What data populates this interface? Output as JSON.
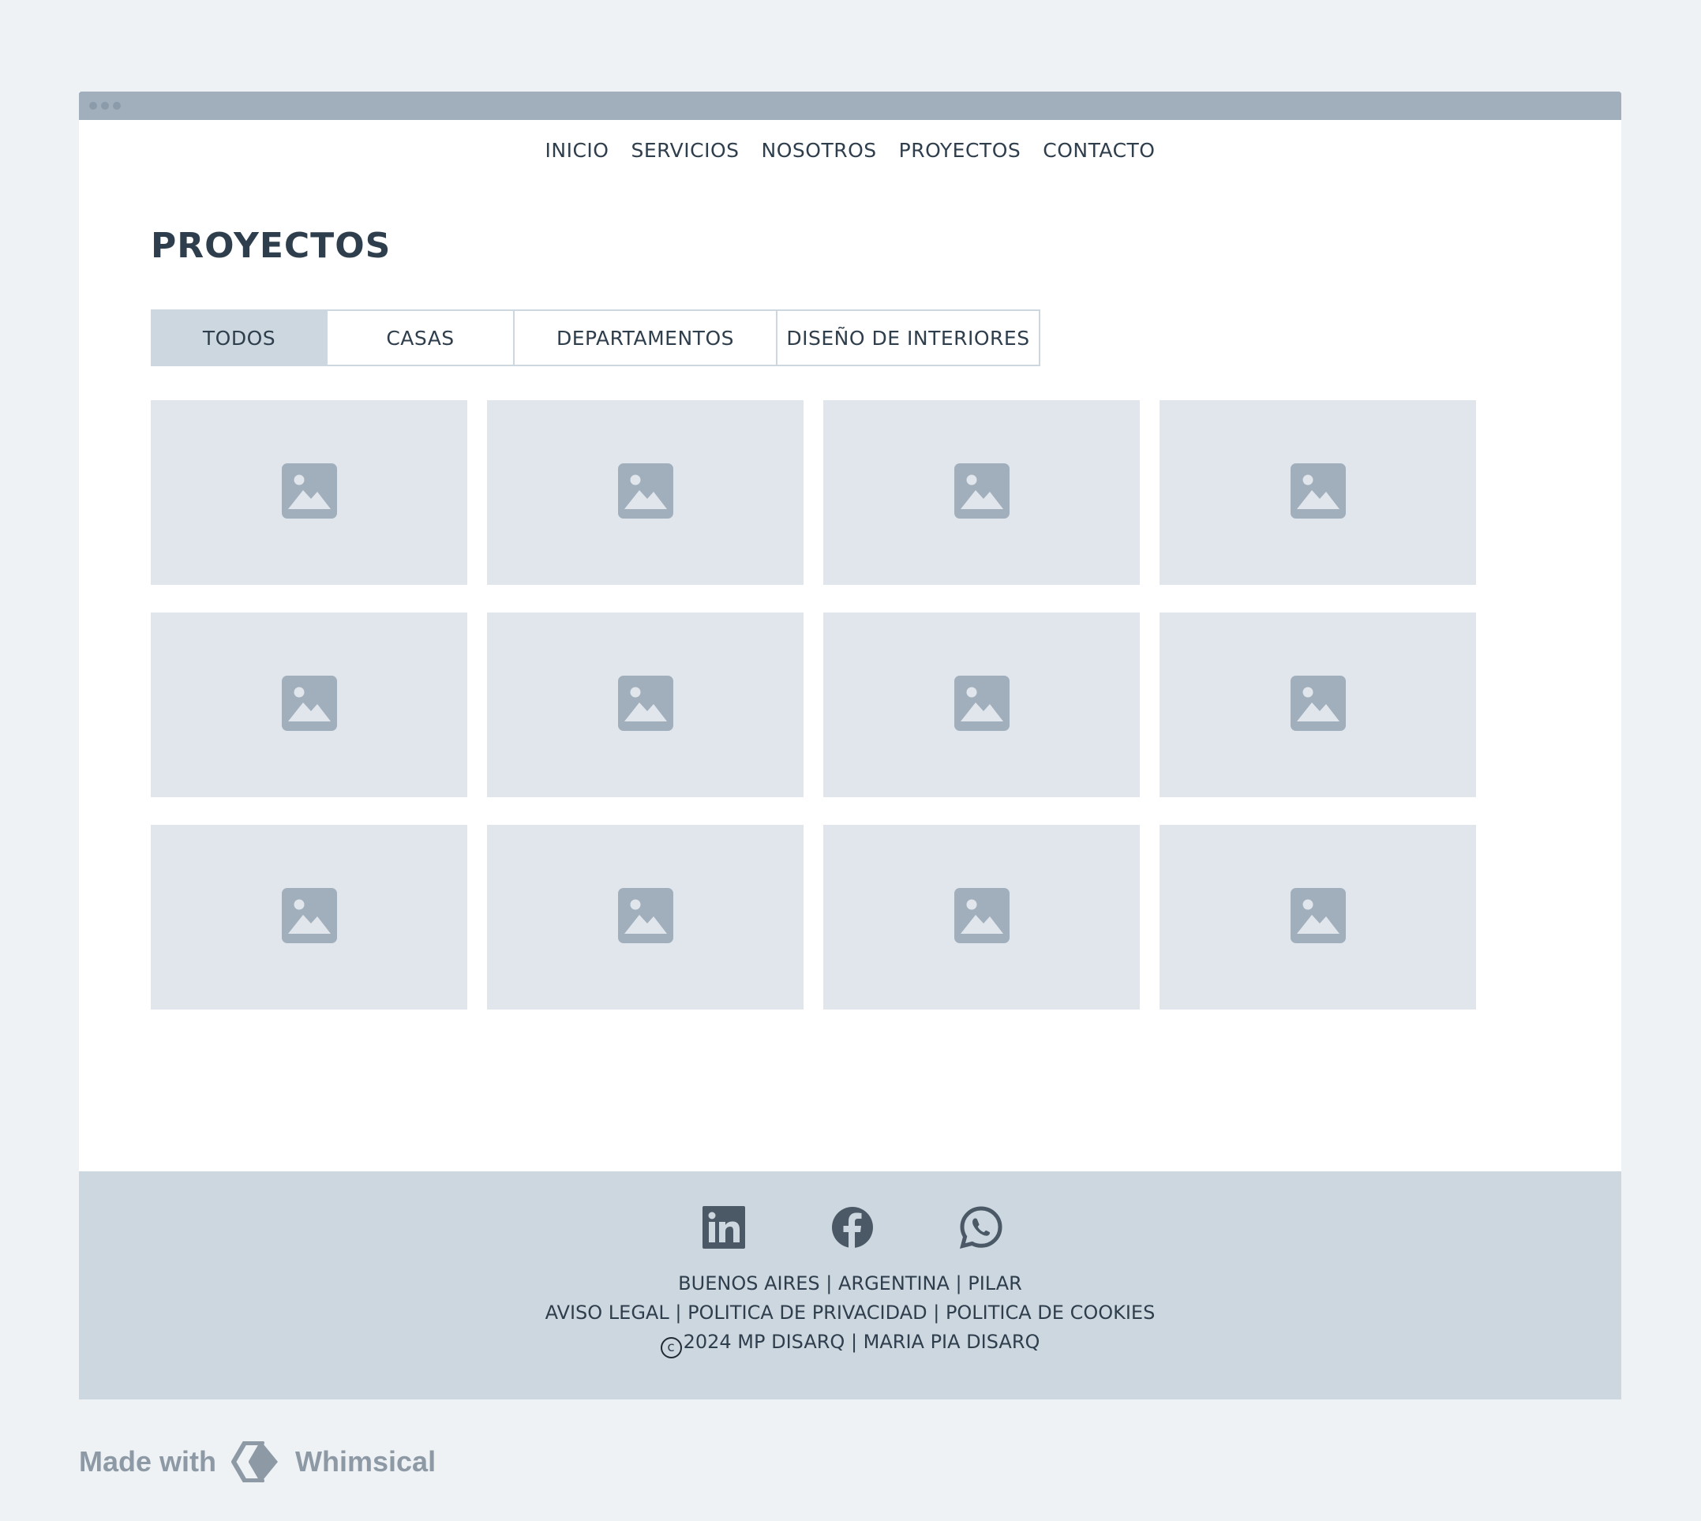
{
  "nav": {
    "items": [
      {
        "label": "INICIO"
      },
      {
        "label": "SERVICIOS"
      },
      {
        "label": "NOSOTROS"
      },
      {
        "label": "PROYECTOS"
      },
      {
        "label": "CONTACTO"
      }
    ]
  },
  "page": {
    "title": "PROYECTOS"
  },
  "filters": {
    "tabs": [
      {
        "label": "TODOS",
        "active": true
      },
      {
        "label": "CASAS",
        "active": false
      },
      {
        "label": "DEPARTAMENTOS",
        "active": false
      },
      {
        "label": "DISEÑO DE INTERIORES",
        "active": false
      }
    ]
  },
  "gallery": {
    "thumbnail_icon": "image-placeholder-icon"
  },
  "footer": {
    "social": [
      "linkedin-icon",
      "facebook-icon",
      "whatsapp-icon"
    ],
    "location": "BUENOS AIRES | ARGENTINA | PILAR",
    "legal": {
      "aviso": "AVISO LEGAL",
      "privacidad": "POLITICA DE PRIVACIDAD",
      "cookies": "POLITICA DE COOKIES",
      "separator": " | "
    },
    "copyright_symbol": "c",
    "copyright": "2024 MP DISARQ | MARIA PIA DISARQ"
  },
  "watermark": {
    "prefix": "Made with",
    "brand": "Whimsical"
  },
  "colors": {
    "background": "#eff2f5",
    "titlebar": "#a1afbc",
    "text": "#2f3e4c",
    "active_tab": "#cdd7e0",
    "thumbnail": "#e1e6ec",
    "thumbnail_icon": "#a1afbc",
    "footer": "#cdd7e0",
    "social_icon": "#4b5966"
  }
}
